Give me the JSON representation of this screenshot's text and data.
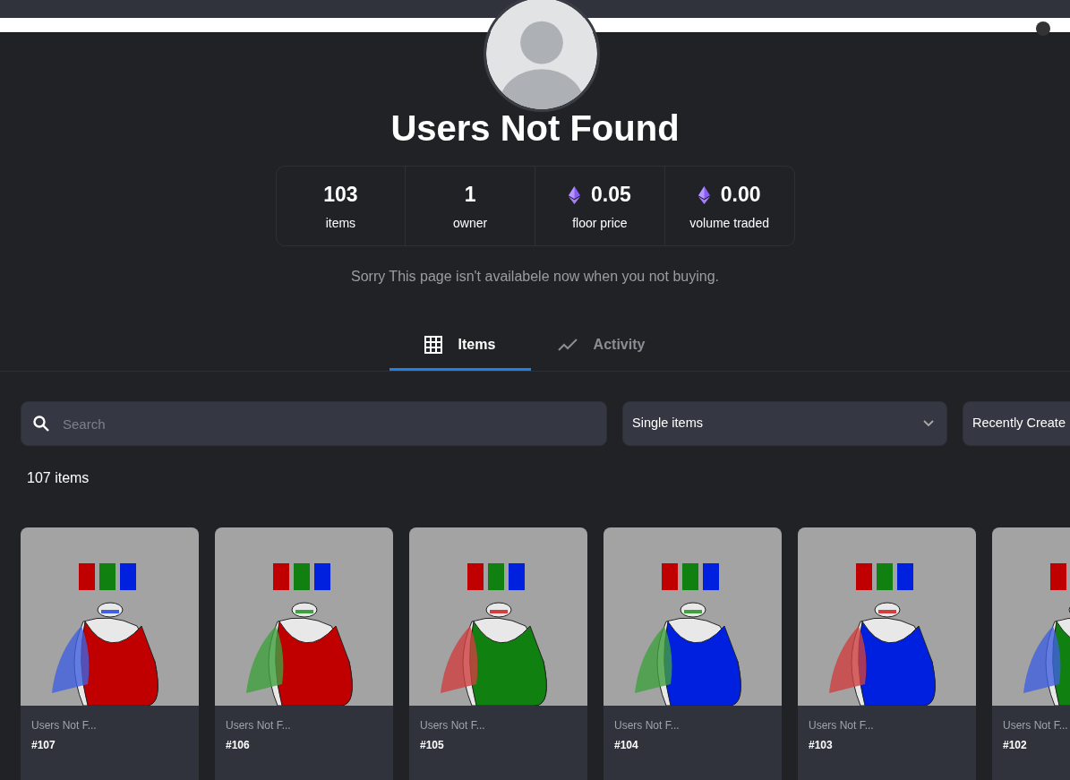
{
  "collection": {
    "title": "Users Not Found",
    "description": "Sorry This page isn't availabele now when you not buying."
  },
  "stats": [
    {
      "value": "103",
      "label": "items",
      "kind": "count"
    },
    {
      "value": "1",
      "label": "owner",
      "kind": "count"
    },
    {
      "value": "0.05",
      "label": "floor price",
      "kind": "eth"
    },
    {
      "value": "0.00",
      "label": "volume traded",
      "kind": "eth"
    }
  ],
  "tabs": [
    {
      "label": "Items",
      "kind": "grid",
      "selected": true
    },
    {
      "label": "Activity",
      "kind": "chart",
      "selected": false
    }
  ],
  "search": {
    "placeholder": "Search"
  },
  "filters": [
    {
      "value": "Single items",
      "kind": "select"
    },
    {
      "value": "Recently Create",
      "kind": "sort"
    }
  ],
  "result_count": "107 items",
  "cards": [
    {
      "kind": "picture",
      "collection": "Users Not F...",
      "name": "#107"
    },
    {
      "kind": "picture",
      "collection": "Users Not F...",
      "name": "#106"
    },
    {
      "kind": "picture",
      "collection": "Users Not F...",
      "name": "#105"
    },
    {
      "kind": "picture",
      "collection": "Users Not F...",
      "name": "#104"
    },
    {
      "kind": "picture",
      "collection": "Users Not F...",
      "name": "#103"
    },
    {
      "kind": "picture",
      "collection": "Users Not F...",
      "name": "#102"
    }
  ]
}
